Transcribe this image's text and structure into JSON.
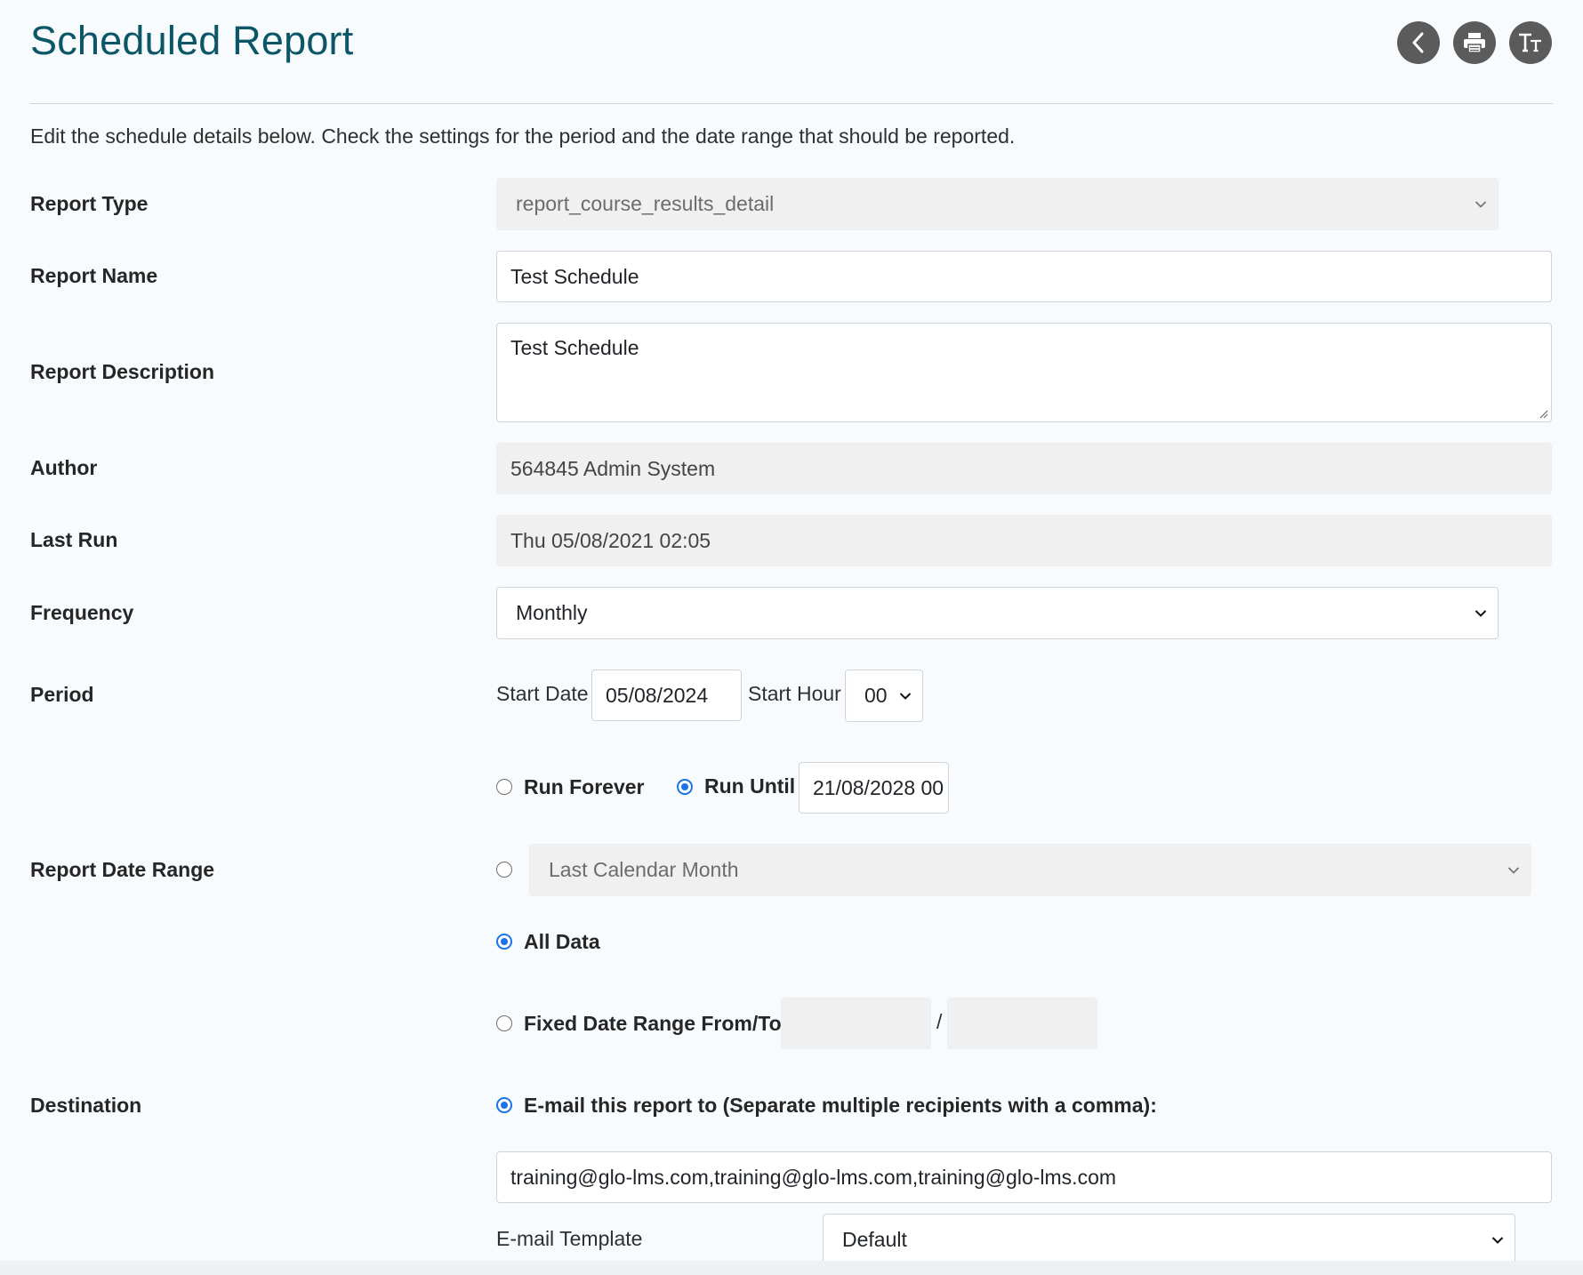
{
  "page": {
    "title": "Scheduled Report",
    "intro": "Edit the schedule details below. Check the settings for the period and the date range that should be reported."
  },
  "header_buttons": {
    "back": "back-icon",
    "print": "print-icon",
    "text_size": "text-size-icon"
  },
  "form": {
    "report_type": {
      "label": "Report Type",
      "value": "report_course_results_detail"
    },
    "report_name": {
      "label": "Report Name",
      "value": "Test Schedule"
    },
    "report_description": {
      "label": "Report Description",
      "value": "Test Schedule"
    },
    "author": {
      "label": "Author",
      "value": "564845 Admin System"
    },
    "last_run": {
      "label": "Last Run",
      "value": "Thu 05/08/2021 02:05"
    },
    "frequency": {
      "label": "Frequency",
      "value": "Monthly"
    },
    "period": {
      "label": "Period",
      "start_date_label": "Start Date",
      "start_date": "05/08/2024",
      "start_hour_label": "Start Hour",
      "start_hour": "00",
      "run_forever_label": "Run Forever",
      "run_until_label": "Run Until",
      "run_until_value": "21/08/2028 00",
      "selected": "run_until"
    },
    "report_date_range": {
      "label": "Report Date Range",
      "relative_value": "Last Calendar Month",
      "all_data_label": "All Data",
      "fixed_label": "Fixed Date Range From/To",
      "separator": "/",
      "selected": "all_data"
    },
    "destination": {
      "label": "Destination",
      "email_option_label": "E-mail this report to (Separate multiple recipients with a comma):",
      "recipients": "training@glo-lms.com,training@glo-lms.com,training@glo-lms.com",
      "template_label": "E-mail Template",
      "template_value": "Default"
    }
  },
  "colors": {
    "title": "#0b5667",
    "radio_selected": "#1a73e8",
    "header_button": "#5b5b5b"
  }
}
